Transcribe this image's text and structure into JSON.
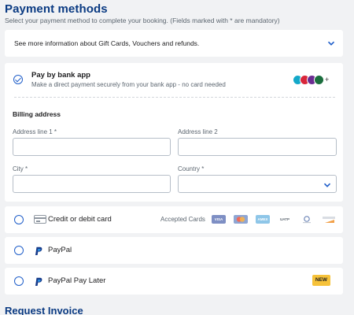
{
  "header": {
    "title": "Payment methods",
    "subtitle": "Select your payment method to complete your booking.   (Fields marked with * are mandatory)"
  },
  "info": {
    "text": "See more information about Gift Cards, Vouchers and refunds."
  },
  "bank": {
    "title": "Pay by bank app",
    "subtitle": "Make a direct payment securely from your bank app - no card needed",
    "selected": true,
    "logo_more": "+"
  },
  "billing": {
    "title": "Billing address",
    "address1_label": "Address line 1 *",
    "address1_value": "",
    "address2_label": "Address line 2",
    "address2_value": "",
    "city_label": "City *",
    "city_value": "",
    "country_label": "Country *",
    "country_value": ""
  },
  "options": {
    "card_label": "Credit or debit card",
    "accepted_label": "Accepted Cards",
    "card_brands": [
      "VISA",
      "MC",
      "AMEX",
      "UATP",
      "DINERS",
      "DISCOVER"
    ],
    "paypal_label": "PayPal",
    "paylater_label": "PayPal Pay Later",
    "new_badge": "NEW"
  },
  "request_invoice": {
    "title": "Request Invoice"
  },
  "colors": {
    "brand_blue": "#0a3a82",
    "accent_blue": "#1f5ec9",
    "badge_yellow": "#f6c23a",
    "background": "#f1f2f4"
  }
}
